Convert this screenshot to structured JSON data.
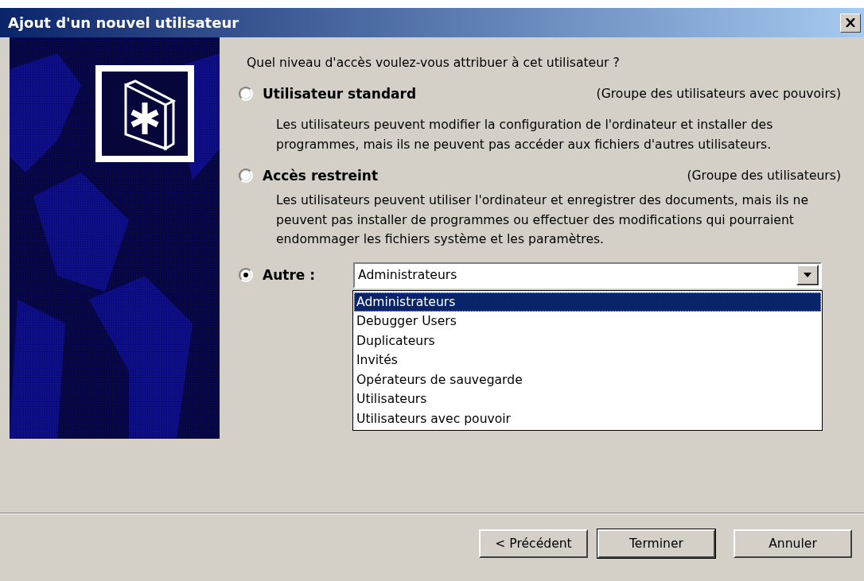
{
  "window": {
    "title": "Ajout d'un nouvel utilisateur"
  },
  "question": "Quel niveau d'accès voulez-vous attribuer à cet utilisateur ?",
  "options": [
    {
      "kind": "described",
      "label": "Utilisateur standard",
      "group": "(Groupe des utilisateurs avec pouvoirs)",
      "description": "Les utilisateurs peuvent modifier la configuration de l'ordinateur et installer des programmes, mais ils ne peuvent pas accéder aux fichiers d'autres utilisateurs.",
      "selected": false
    },
    {
      "kind": "described",
      "label": "Accès restreint",
      "group": "(Groupe des utilisateurs)",
      "description": "Les utilisateurs peuvent utiliser l'ordinateur et enregistrer des documents, mais ils ne peuvent pas installer de programmes ou effectuer des modifications qui pourraient endommager les fichiers système et les paramètres.",
      "selected": false
    },
    {
      "kind": "dropdown",
      "label": "Autre :",
      "selected": true,
      "dropdown": {
        "value": "Administrateurs",
        "expanded": true,
        "items": [
          {
            "label": "Administrateurs",
            "selected": true
          },
          {
            "label": "Debugger Users",
            "selected": false
          },
          {
            "label": "Duplicateurs",
            "selected": false
          },
          {
            "label": "Invités",
            "selected": false
          },
          {
            "label": "Opérateurs de sauvegarde",
            "selected": false
          },
          {
            "label": "Utilisateurs",
            "selected": false
          },
          {
            "label": "Utilisateurs avec pouvoir",
            "selected": false
          }
        ]
      }
    }
  ],
  "buttons": [
    {
      "label": "< Précédent",
      "default": false
    },
    {
      "label": "Terminer",
      "default": true
    },
    {
      "label": "Annuler",
      "default": false
    }
  ]
}
